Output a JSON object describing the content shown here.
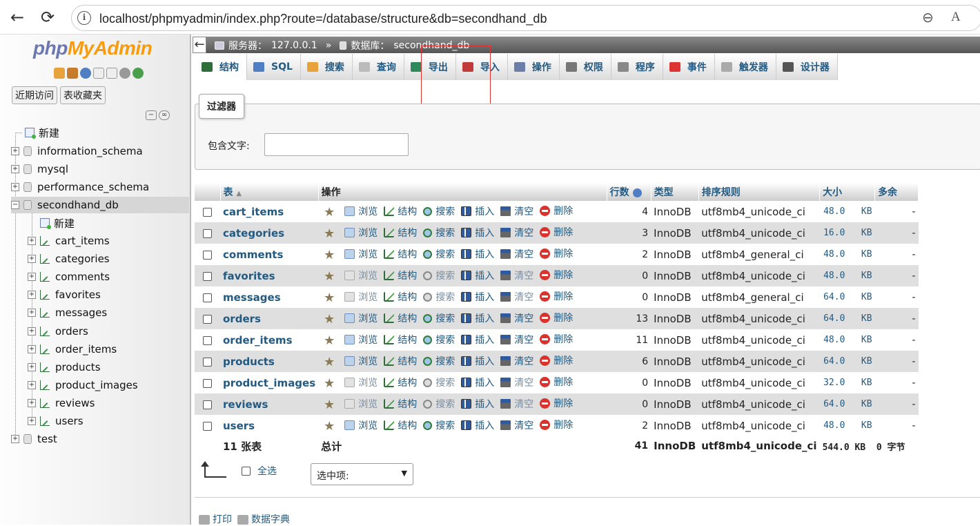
{
  "browser": {
    "url": "localhost/phpmyadmin/index.php?route=/database/structure&db=secondhand_db",
    "back_icon": "←",
    "reload_icon": "⟳",
    "info_icon": "i",
    "zoom_icon": "⊖",
    "read_icon": "A"
  },
  "sidebar": {
    "logo_php": "php",
    "logo_myadmin": "MyAdmin",
    "recent_label": "近期访问",
    "favorites_label": "表收藏夹",
    "new_label": "新建",
    "databases": [
      {
        "name": "information_schema"
      },
      {
        "name": "mysql"
      },
      {
        "name": "performance_schema"
      },
      {
        "name": "secondhand_db"
      },
      {
        "name": "test"
      }
    ],
    "sub_new_label": "新建",
    "tables": [
      "cart_items",
      "categories",
      "comments",
      "favorites",
      "messages",
      "orders",
      "order_items",
      "products",
      "product_images",
      "reviews",
      "users"
    ]
  },
  "breadcrumb": {
    "server_label": "服务器：",
    "server_value": "127.0.0.1",
    "separator": "»",
    "db_label": "数据库：",
    "db_value": "secondhand_db"
  },
  "tabs": [
    "结构",
    "SQL",
    "搜索",
    "查询",
    "导出",
    "导入",
    "操作",
    "权限",
    "程序",
    "事件",
    "触发器",
    "设计器"
  ],
  "filter": {
    "legend": "过滤器",
    "label": "包含文字:",
    "value": ""
  },
  "table": {
    "headers": {
      "name": "表",
      "actions": "操作",
      "rows": "行数",
      "type": "类型",
      "collation": "排序规则",
      "size": "大小",
      "overhead": "多余"
    },
    "action_labels": {
      "browse": "浏览",
      "structure": "结构",
      "search": "搜索",
      "insert": "插入",
      "empty": "清空",
      "drop": "删除"
    },
    "rows": [
      {
        "name": "cart_items",
        "rows": "4",
        "engine": "InnoDB",
        "collation": "utf8mb4_unicode_ci",
        "size": "48.0",
        "unit": "KB",
        "overhead": "-"
      },
      {
        "name": "categories",
        "rows": "3",
        "engine": "InnoDB",
        "collation": "utf8mb4_unicode_ci",
        "size": "16.0",
        "unit": "KB",
        "overhead": "-"
      },
      {
        "name": "comments",
        "rows": "2",
        "engine": "InnoDB",
        "collation": "utf8mb4_general_ci",
        "size": "48.0",
        "unit": "KB",
        "overhead": "-"
      },
      {
        "name": "favorites",
        "rows": "0",
        "engine": "InnoDB",
        "collation": "utf8mb4_unicode_ci",
        "size": "48.0",
        "unit": "KB",
        "overhead": "-"
      },
      {
        "name": "messages",
        "rows": "0",
        "engine": "InnoDB",
        "collation": "utf8mb4_general_ci",
        "size": "64.0",
        "unit": "KB",
        "overhead": "-"
      },
      {
        "name": "orders",
        "rows": "13",
        "engine": "InnoDB",
        "collation": "utf8mb4_unicode_ci",
        "size": "64.0",
        "unit": "KB",
        "overhead": "-"
      },
      {
        "name": "order_items",
        "rows": "11",
        "engine": "InnoDB",
        "collation": "utf8mb4_unicode_ci",
        "size": "48.0",
        "unit": "KB",
        "overhead": "-"
      },
      {
        "name": "products",
        "rows": "6",
        "engine": "InnoDB",
        "collation": "utf8mb4_unicode_ci",
        "size": "64.0",
        "unit": "KB",
        "overhead": "-"
      },
      {
        "name": "product_images",
        "rows": "0",
        "engine": "InnoDB",
        "collation": "utf8mb4_unicode_ci",
        "size": "32.0",
        "unit": "KB",
        "overhead": "-"
      },
      {
        "name": "reviews",
        "rows": "0",
        "engine": "InnoDB",
        "collation": "utf8mb4_unicode_ci",
        "size": "64.0",
        "unit": "KB",
        "overhead": "-"
      },
      {
        "name": "users",
        "rows": "2",
        "engine": "InnoDB",
        "collation": "utf8mb4_unicode_ci",
        "size": "48.0",
        "unit": "KB",
        "overhead": "-"
      }
    ],
    "summary": {
      "count": "11 张表",
      "total": "总计",
      "rows": "41",
      "engine": "InnoDB",
      "collation": "utf8mb4_unicode_ci",
      "size": "544.0 KB",
      "overhead": "0 字节"
    }
  },
  "bottom": {
    "select_all": "全选",
    "with_selected": "选中项:"
  },
  "footer": {
    "print": "打印",
    "dictionary": "数据字典"
  },
  "colors": {
    "link": "#235a81",
    "logo_php": "#6c78af",
    "logo_myadmin": "#f89c0e",
    "highlight_box": "#e03030"
  }
}
